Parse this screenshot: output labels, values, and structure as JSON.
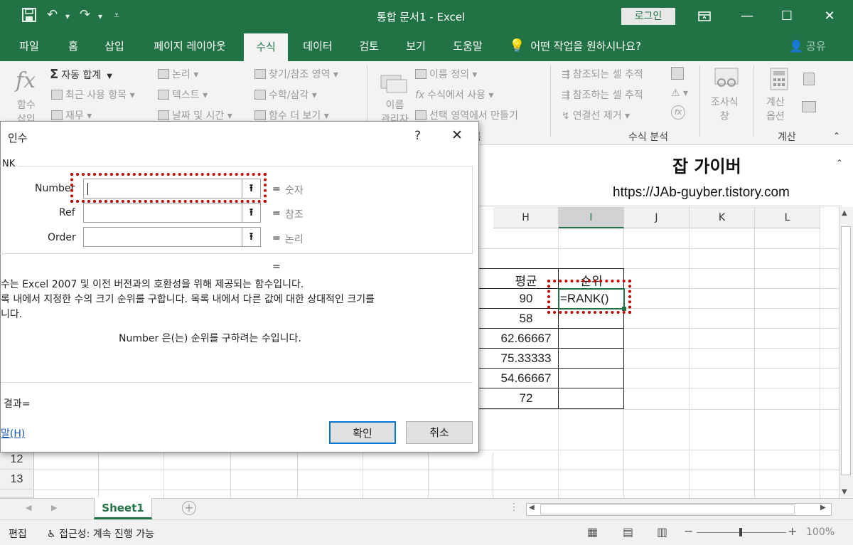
{
  "window": {
    "title": "통합 문서1  -  Excel",
    "login_label": "로그인",
    "accent": "#217346"
  },
  "tabs": [
    {
      "label": "파일"
    },
    {
      "label": "홈"
    },
    {
      "label": "삽입"
    },
    {
      "label": "페이지 레이아웃"
    },
    {
      "label": "수식",
      "active": true
    },
    {
      "label": "데이터"
    },
    {
      "label": "검토"
    },
    {
      "label": "보기"
    },
    {
      "label": "도움말"
    }
  ],
  "tell_me": "어떤 작업을 원하시나요?",
  "share_label": "공유",
  "ribbon": {
    "insert_function": "함수\n삽입",
    "autosum": "자동 합계",
    "recent": "최근 사용 항목",
    "financial": "재무",
    "logical": "논리",
    "text": "텍스트",
    "datetime": "날짜 및 시간",
    "lookup": "찾기/참조 영역",
    "math": "수학/삼각",
    "more": "함수 더 보기",
    "name_manager": "이름\n관리자",
    "define_name": "이름 정의",
    "use_in_formula": "수식에서 사용",
    "create_from_selection": "선택 영역에서 만들기",
    "trace_precedents": "참조되는 셀 추적",
    "trace_dependents": "참조하는 셀 추적",
    "remove_arrows": "연결선 제거",
    "watch_window": "조사식\n창",
    "calc_options": "계산\n옵션",
    "group_auditing": "수식 분석",
    "group_calc": "계산",
    "group_names_tail": "름"
  },
  "watermark": {
    "title": "잡 가이버",
    "url": "https://JAb-guyber.tistory.com"
  },
  "sheet": {
    "columns": [
      "H",
      "I",
      "J",
      "K",
      "L"
    ],
    "header_avg": "평균",
    "header_rank": "순위",
    "avg_values": [
      "90",
      "58",
      "62.66667",
      "75.33333",
      "54.66667",
      "72"
    ],
    "formula_cell": "=RANK()",
    "row_numbers": [
      "12",
      "13"
    ],
    "sheet_tab": "Sheet1",
    "highlight_color": "#c00000"
  },
  "dialog": {
    "title": "인수",
    "help_glyph": "?",
    "close_glyph": "✕",
    "group_label": "NK",
    "fields": [
      {
        "label": "Number",
        "hint": "숫자"
      },
      {
        "label": "Ref",
        "hint": "참조"
      },
      {
        "label": "Order",
        "hint": "논리"
      }
    ],
    "equals": "=",
    "description_line1": "수는 Excel 2007 및 이전 버전과의 호환성을 위해 제공되는 함수입니다.",
    "description_line2": "록 내에서 지정한 수의 크기 순위를 구합니다. 목록 내에서 다른 값에 대한 상대적인 크기를",
    "description_line3": "니다.",
    "arg_help": "Number  은(는) 순위를 구하려는 수입니다.",
    "result_label": "결과=",
    "help_link": "말(H)",
    "ok_label": "확인",
    "cancel_label": "취소"
  },
  "status": {
    "mode": "편집",
    "accessibility": "접근성: 계속 진행 가능",
    "zoom": "100%"
  }
}
